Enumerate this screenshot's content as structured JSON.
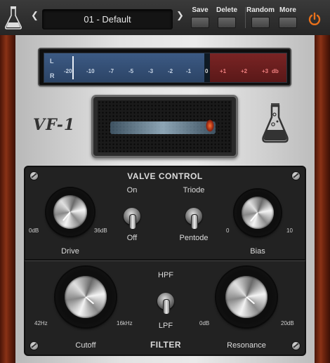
{
  "toolbar": {
    "preset_name": "01 - Default",
    "prev_arrow": "❮",
    "next_arrow": "❯",
    "save_label": "Save",
    "delete_label": "Delete",
    "random_label": "Random",
    "more_label": "More",
    "power_icon": "power-icon",
    "logo_icon": "flask-icon",
    "power_color": "#e8701a"
  },
  "meter": {
    "channel_left": "L",
    "channel_right": "R",
    "scale": [
      "-20",
      "-10",
      "-7",
      "-5",
      "-3",
      "-2",
      "-1"
    ],
    "zero": "0",
    "red_scale": [
      "+1",
      "+2",
      "+3"
    ],
    "unit": "db",
    "blue_color": "#3c5a84",
    "red_color": "#7a2424"
  },
  "brand": {
    "name": "VF-1",
    "logo_icon": "flask-icon"
  },
  "valve_control": {
    "title": "VALVE CONTROL",
    "drive": {
      "label": "Drive",
      "min": "0dB",
      "max": "36dB"
    },
    "onoff": {
      "top": "On",
      "bottom": "Off",
      "state": "Off"
    },
    "mode": {
      "top": "Triode",
      "bottom": "Pentode",
      "state": "Pentode"
    },
    "bias": {
      "label": "Bias",
      "min": "0",
      "max": "10"
    }
  },
  "filter": {
    "title": "FILTER",
    "cutoff": {
      "label": "Cutoff",
      "min": "42Hz",
      "max": "16kHz"
    },
    "type": {
      "top": "HPF",
      "bottom": "LPF",
      "state": "LPF"
    },
    "resonance": {
      "label": "Resonance",
      "min": "0dB",
      "max": "20dB"
    }
  }
}
